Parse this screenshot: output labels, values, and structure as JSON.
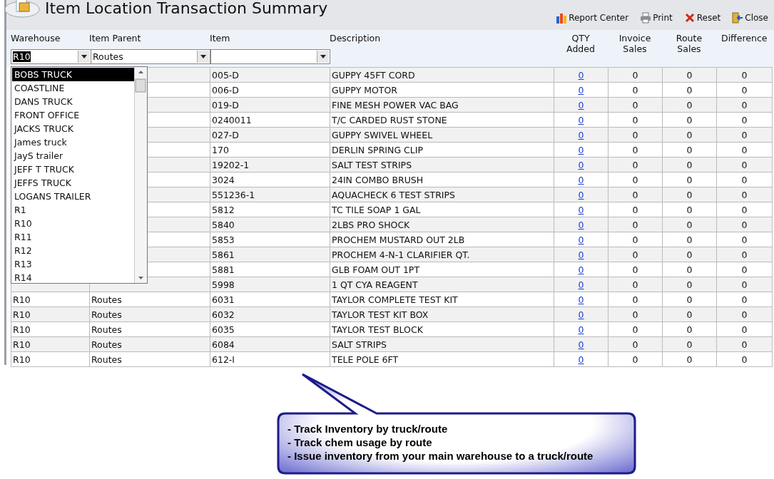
{
  "window": {
    "title": "Item Location Transaction Summary"
  },
  "toolbar": [
    {
      "label": "Report Center",
      "kind": "report"
    },
    {
      "label": "Print",
      "kind": "print"
    },
    {
      "label": "Reset",
      "kind": "reset"
    },
    {
      "label": "Close",
      "kind": "close"
    }
  ],
  "filters": {
    "columns": [
      "Warehouse",
      "Item Parent",
      "Item",
      "Description"
    ],
    "warehouse": "R10",
    "item_parent": "Routes"
  },
  "table": {
    "columns": [
      "QTY Added",
      "Invoice Sales",
      "Route Sales",
      "Difference"
    ],
    "rows": [
      {
        "item": "005-D",
        "description": "GUPPY 45FT CORD",
        "qty_added": "0",
        "invoice_sales": "0",
        "route_sales": "0",
        "difference": "0"
      },
      {
        "item": "006-D",
        "description": "GUPPY MOTOR",
        "qty_added": "0",
        "invoice_sales": "0",
        "route_sales": "0",
        "difference": "0"
      },
      {
        "item": "019-D",
        "description": "FINE MESH POWER VAC BAG",
        "qty_added": "0",
        "invoice_sales": "0",
        "route_sales": "0",
        "difference": "0"
      },
      {
        "item": "0240011",
        "description": "T/C CARDED RUST STONE",
        "qty_added": "0",
        "invoice_sales": "0",
        "route_sales": "0",
        "difference": "0"
      },
      {
        "item": "027-D",
        "description": "GUPPY SWIVEL WHEEL",
        "qty_added": "0",
        "invoice_sales": "0",
        "route_sales": "0",
        "difference": "0"
      },
      {
        "item": "170",
        "description": "DERLIN SPRING CLIP",
        "qty_added": "0",
        "invoice_sales": "0",
        "route_sales": "0",
        "difference": "0"
      },
      {
        "item": "19202-1",
        "description": "SALT TEST STRIPS",
        "qty_added": "0",
        "invoice_sales": "0",
        "route_sales": "0",
        "difference": "0"
      },
      {
        "item": "3024",
        "description": "24IN COMBO BRUSH",
        "qty_added": "0",
        "invoice_sales": "0",
        "route_sales": "0",
        "difference": "0"
      },
      {
        "item": "551236-1",
        "description": "AQUACHECK 6 TEST STRIPS",
        "qty_added": "0",
        "invoice_sales": "0",
        "route_sales": "0",
        "difference": "0"
      },
      {
        "item": "5812",
        "description": "TC TILE SOAP 1 GAL",
        "qty_added": "0",
        "invoice_sales": "0",
        "route_sales": "0",
        "difference": "0"
      },
      {
        "item": "5840",
        "description": "2LBS PRO SHOCK",
        "qty_added": "0",
        "invoice_sales": "0",
        "route_sales": "0",
        "difference": "0"
      },
      {
        "item": "5853",
        "description": "PROCHEM MUSTARD OUT 2LB",
        "qty_added": "0",
        "invoice_sales": "0",
        "route_sales": "0",
        "difference": "0"
      },
      {
        "item": "5861",
        "description": "PROCHEM 4-N-1 CLARIFIER QT.",
        "qty_added": "0",
        "invoice_sales": "0",
        "route_sales": "0",
        "difference": "0"
      },
      {
        "item": "5881",
        "description": "GLB FOAM OUT 1PT",
        "qty_added": "0",
        "invoice_sales": "0",
        "route_sales": "0",
        "difference": "0"
      },
      {
        "item": "5998",
        "description": "1 QT CYA REAGENT",
        "qty_added": "0",
        "invoice_sales": "0",
        "route_sales": "0",
        "difference": "0"
      },
      {
        "warehouse": "R10",
        "item_parent": "Routes",
        "item": "6031",
        "description": "TAYLOR COMPLETE TEST KIT",
        "qty_added": "0",
        "invoice_sales": "0",
        "route_sales": "0",
        "difference": "0"
      },
      {
        "warehouse": "R10",
        "item_parent": "Routes",
        "item": "6032",
        "description": "TAYLOR TEST KIT BOX",
        "qty_added": "0",
        "invoice_sales": "0",
        "route_sales": "0",
        "difference": "0"
      },
      {
        "warehouse": "R10",
        "item_parent": "Routes",
        "item": "6035",
        "description": "TAYLOR TEST BLOCK",
        "qty_added": "0",
        "invoice_sales": "0",
        "route_sales": "0",
        "difference": "0"
      },
      {
        "warehouse": "R10",
        "item_parent": "Routes",
        "item": "6084",
        "description": "SALT STRIPS",
        "qty_added": "0",
        "invoice_sales": "0",
        "route_sales": "0",
        "difference": "0"
      },
      {
        "warehouse": "R10",
        "item_parent": "Routes",
        "item": "612-I",
        "description": "TELE POLE 6FT",
        "qty_added": "0",
        "invoice_sales": "0",
        "route_sales": "0",
        "difference": "0"
      }
    ]
  },
  "dropdown": {
    "options": [
      {
        "label": "BOBS TRUCK",
        "selected": true
      },
      {
        "label": "COASTLINE",
        "selected": false
      },
      {
        "label": "DANS TRUCK",
        "selected": false
      },
      {
        "label": "FRONT OFFICE",
        "selected": false
      },
      {
        "label": "JACKS TRUCK",
        "selected": false
      },
      {
        "label": "James truck",
        "selected": false
      },
      {
        "label": "JayS trailer",
        "selected": false
      },
      {
        "label": "JEFF T TRUCK",
        "selected": false
      },
      {
        "label": "JEFFS TRUCK",
        "selected": false
      },
      {
        "label": "LOGANS TRAILER",
        "selected": false
      },
      {
        "label": "R1",
        "selected": false
      },
      {
        "label": "R10",
        "selected": false
      },
      {
        "label": "R11",
        "selected": false
      },
      {
        "label": "R12",
        "selected": false
      },
      {
        "label": "R13",
        "selected": false
      },
      {
        "label": "R14",
        "selected": false
      }
    ]
  },
  "callout": {
    "lines": [
      "- Track Inventory by truck/route",
      "- Track chem usage by route",
      "- Issue inventory from your main warehouse to a truck/route"
    ]
  }
}
